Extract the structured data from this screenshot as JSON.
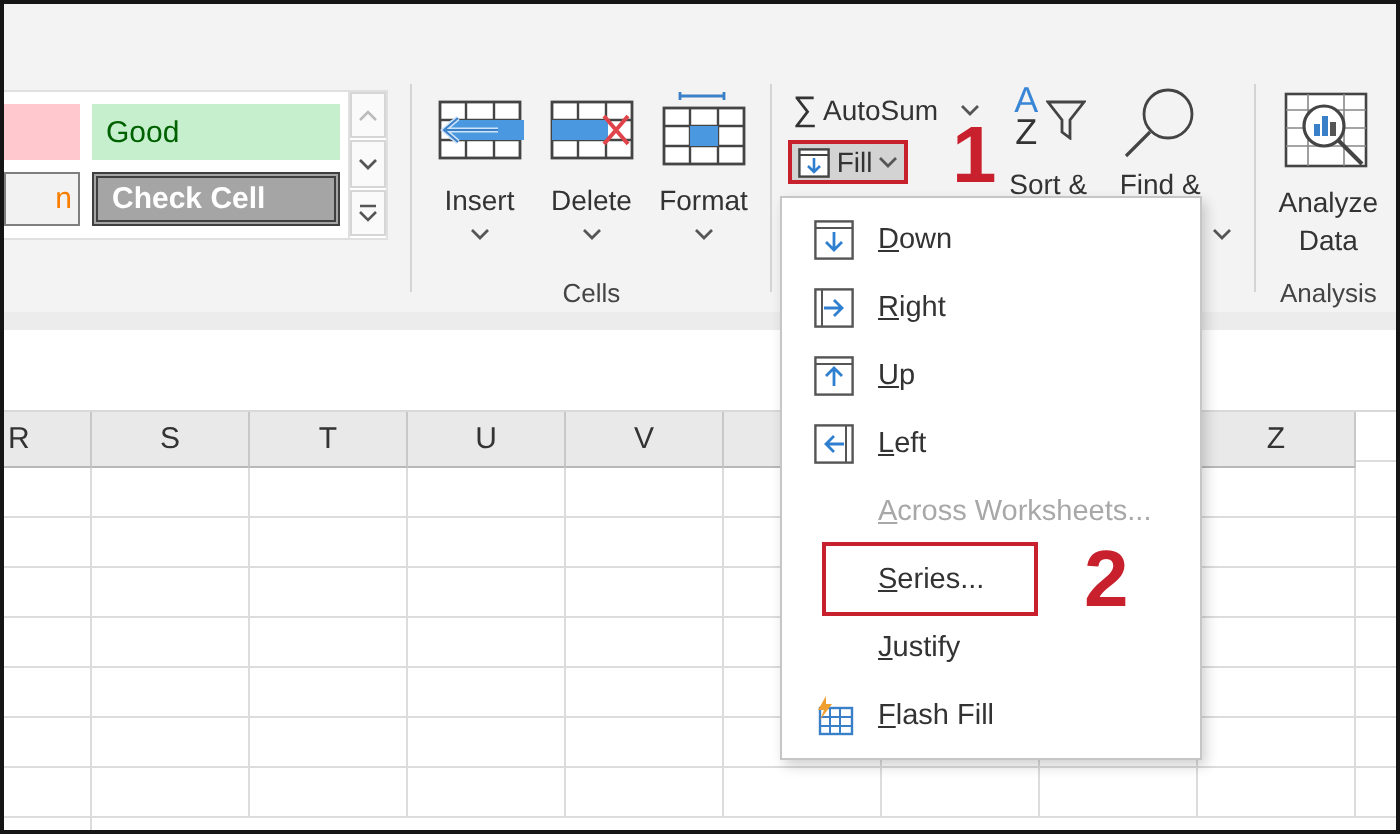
{
  "styles_gallery": {
    "cells": [
      {
        "kind": "bad"
      },
      {
        "kind": "good",
        "text": "Good"
      },
      {
        "kind": "calculation",
        "text": "n"
      },
      {
        "kind": "check",
        "text": "Check Cell"
      }
    ]
  },
  "cells_group": {
    "label": "Cells",
    "buttons": [
      {
        "kind": "insert",
        "label": "Insert"
      },
      {
        "kind": "delete",
        "label": "Delete"
      },
      {
        "kind": "format",
        "label": "Format"
      }
    ]
  },
  "editing_group": {
    "autosum": {
      "glyph": "∑",
      "label": "AutoSum"
    },
    "fill": {
      "label": "Fill",
      "highlighted": true
    },
    "sort_filter": {
      "icon_letters": [
        "A",
        "Z"
      ],
      "label": "Sort &"
    },
    "find_select": {
      "label": "Find &"
    }
  },
  "analysis_group": {
    "label": "Analysis",
    "button": {
      "label": "Analyze Data"
    }
  },
  "fill_menu": {
    "items": [
      {
        "kind": "down",
        "label": "Down",
        "disabled": false,
        "annotated": false
      },
      {
        "kind": "right",
        "label": "Right",
        "disabled": false,
        "annotated": false
      },
      {
        "kind": "up",
        "label": "Up",
        "disabled": false,
        "annotated": false
      },
      {
        "kind": "left",
        "label": "Left",
        "disabled": false,
        "annotated": false
      },
      {
        "kind": "none",
        "label": "Across Worksheets...",
        "disabled": true,
        "annotated": false
      },
      {
        "kind": "none",
        "label": "Series...",
        "disabled": false,
        "annotated": true
      },
      {
        "kind": "none",
        "label": "Justify",
        "disabled": false,
        "annotated": false
      },
      {
        "kind": "flash",
        "label": "Flash Fill",
        "disabled": false,
        "annotated": false
      }
    ]
  },
  "annotations": [
    {
      "kind": "fill",
      "text": "1"
    },
    {
      "kind": "series",
      "text": "2"
    }
  ],
  "sheet": {
    "columns": [
      {
        "label": "R",
        "follows_covered": false
      },
      {
        "label": "S",
        "follows_covered": false
      },
      {
        "label": "T",
        "follows_covered": false
      },
      {
        "label": "U",
        "follows_covered": false
      },
      {
        "label": "V",
        "follows_covered": false
      },
      {
        "label": "Z",
        "follows_covered": true
      }
    ]
  }
}
